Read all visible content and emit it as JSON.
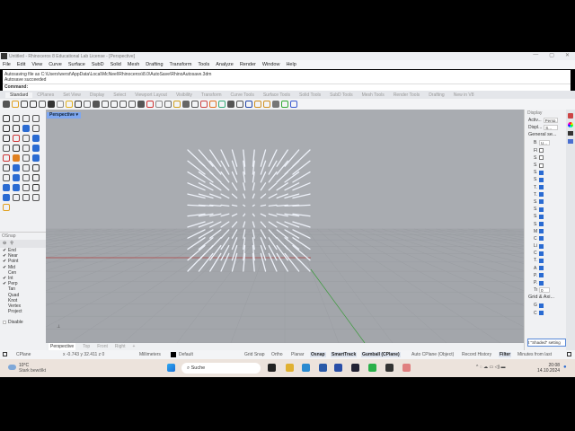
{
  "window": {
    "title": "Untitled - Rhinoceros 8 Educational Lab License - [Perspective]",
    "controls": [
      "—",
      "▢",
      "✕"
    ]
  },
  "menu": [
    "File",
    "Edit",
    "View",
    "Curve",
    "Surface",
    "SubD",
    "Solid",
    "Mesh",
    "Drafting",
    "Transform",
    "Tools",
    "Analyze",
    "Render",
    "Window",
    "Help"
  ],
  "command": {
    "history": [
      "Autosaving file as C:\\Users\\werst\\AppData\\Local\\McNeel\\Rhinoceros\\8.0\\AutoSave\\RhinoAutosave.3dm",
      "Autosave succeeded"
    ],
    "prompt": "Command:"
  },
  "toolbar_tabs": [
    "Standard",
    "CPlanes",
    "Set View",
    "Display",
    "Select",
    "Viewport Layout",
    "Visibility",
    "Transform",
    "Curve Tools",
    "Surface Tools",
    "Solid Tools",
    "SubD Tools",
    "Mesh Tools",
    "Render Tools",
    "Drafting",
    "New in V8"
  ],
  "osnap": {
    "title": "OSnap",
    "items": [
      {
        "label": "End",
        "checked": true
      },
      {
        "label": "Near",
        "checked": true
      },
      {
        "label": "Point",
        "checked": true
      },
      {
        "label": "Mid",
        "checked": true
      },
      {
        "label": "Cen",
        "checked": false
      },
      {
        "label": "Int",
        "checked": true
      },
      {
        "label": "Perp",
        "checked": true
      },
      {
        "label": "Tan",
        "checked": false
      },
      {
        "label": "Quad",
        "checked": false
      },
      {
        "label": "Knot",
        "checked": false
      },
      {
        "label": "Vertex",
        "checked": false
      },
      {
        "label": "Project",
        "checked": false
      }
    ],
    "disable": "Disable"
  },
  "viewport": {
    "active_label": "Perspective",
    "tabs": [
      "Perspective",
      "Top",
      "Front",
      "Right",
      "+"
    ]
  },
  "display_panel": {
    "title": "Display",
    "active_label": "Activ...",
    "active_value": "Persp...",
    "display_label": "Displ...",
    "display_value": "S...",
    "general_section": "General se...",
    "rows": [
      {
        "label": "B...",
        "type": "select",
        "value": "U..."
      },
      {
        "label": "Fl...",
        "checked": false
      },
      {
        "label": "S...",
        "checked": false
      },
      {
        "label": "S...",
        "checked": false
      },
      {
        "label": "S...",
        "checked": true
      },
      {
        "label": "S...",
        "checked": true
      },
      {
        "label": "T...",
        "checked": true
      },
      {
        "label": "T...",
        "checked": true
      },
      {
        "label": "S...",
        "checked": true
      },
      {
        "label": "S...",
        "checked": true
      },
      {
        "label": "S...",
        "checked": true
      },
      {
        "label": "S...",
        "checked": true
      },
      {
        "label": "M...",
        "checked": true
      },
      {
        "label": "C...",
        "checked": true
      },
      {
        "label": "Li...",
        "checked": true
      },
      {
        "label": "C...",
        "checked": true
      },
      {
        "label": "T...",
        "checked": true
      },
      {
        "label": "A...",
        "checked": true
      },
      {
        "label": "P...",
        "checked": true
      },
      {
        "label": "P...",
        "checked": true
      },
      {
        "label": "Tr...",
        "type": "number",
        "value": "0"
      }
    ],
    "grid_section": "Grid & Axi...",
    "grid_rows": [
      {
        "label": "G...",
        "checked": true
      },
      {
        "label": "C...",
        "checked": true
      }
    ],
    "tooltip": "t \"Shaded\" setting"
  },
  "statusbar": {
    "cplane": "CPlane",
    "coords": "x -0.743  y 32.411  z 0",
    "units": "Millimeters",
    "layer": "Default",
    "toggles": [
      {
        "label": "Grid Snap",
        "on": false
      },
      {
        "label": "Ortho",
        "on": false
      },
      {
        "label": "Planar",
        "on": false
      },
      {
        "label": "Osnap",
        "on": true
      },
      {
        "label": "SmartTrack",
        "on": true
      },
      {
        "label": "Gumball (CPlane)",
        "on": true
      },
      {
        "label": "Auto CPlane (Object)",
        "on": false
      },
      {
        "label": "Record History",
        "on": false
      },
      {
        "label": "Filter",
        "on": true
      },
      {
        "label": "Minutes from last",
        "on": false
      }
    ]
  },
  "taskbar": {
    "weather_temp": "10°C",
    "weather_desc": "Stark bewölkt",
    "search": "Suche",
    "time": "20:08",
    "date": "14.10.2024"
  },
  "colors": {
    "viewport_bg": "#a9acb1",
    "accent": "#2a6bd2",
    "viewport_tab": "#7ea7f0",
    "x_axis": "#b04040",
    "y_axis": "#3a9a3a"
  }
}
